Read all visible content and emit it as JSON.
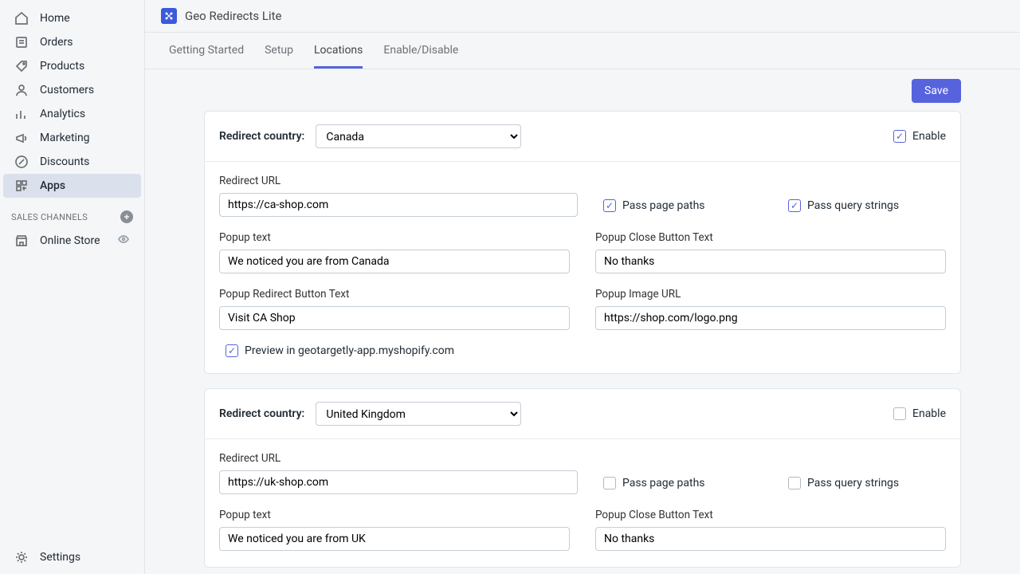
{
  "sidebar": {
    "items": [
      {
        "label": "Home",
        "icon": "home"
      },
      {
        "label": "Orders",
        "icon": "orders"
      },
      {
        "label": "Products",
        "icon": "tag"
      },
      {
        "label": "Customers",
        "icon": "person"
      },
      {
        "label": "Analytics",
        "icon": "chart"
      },
      {
        "label": "Marketing",
        "icon": "horn"
      },
      {
        "label": "Discounts",
        "icon": "discount"
      },
      {
        "label": "Apps",
        "icon": "apps"
      }
    ],
    "section_header": "SALES CHANNELS",
    "channels": [
      {
        "label": "Online Store",
        "icon": "store"
      }
    ],
    "settings_label": "Settings"
  },
  "header": {
    "app_title": "Geo Redirects Lite"
  },
  "tabs": [
    {
      "label": "Getting Started"
    },
    {
      "label": "Setup"
    },
    {
      "label": "Locations"
    },
    {
      "label": "Enable/Disable"
    }
  ],
  "save_label": "Save",
  "enable_label": "Enable",
  "labels": {
    "redirect_country": "Redirect country:",
    "redirect_url": "Redirect URL",
    "pass_paths": "Pass page paths",
    "pass_query": "Pass query strings",
    "popup_text": "Popup text",
    "popup_close": "Popup Close Button Text",
    "popup_redirect": "Popup Redirect Button Text",
    "popup_image": "Popup Image URL",
    "preview_prefix": "Preview in geotargetly-app.myshopify.com"
  },
  "cards": [
    {
      "country": "Canada",
      "enabled": true,
      "redirect_url": "https://ca-shop.com",
      "pass_paths": true,
      "pass_query": true,
      "popup_text": "We noticed you are from Canada",
      "popup_close": "No thanks",
      "popup_redirect": "Visit CA Shop",
      "popup_image": "https://shop.com/logo.png",
      "preview": true
    },
    {
      "country": "United Kingdom",
      "enabled": false,
      "redirect_url": "https://uk-shop.com",
      "pass_paths": false,
      "pass_query": false,
      "popup_text": "We noticed you are from UK",
      "popup_close": "No thanks"
    }
  ]
}
